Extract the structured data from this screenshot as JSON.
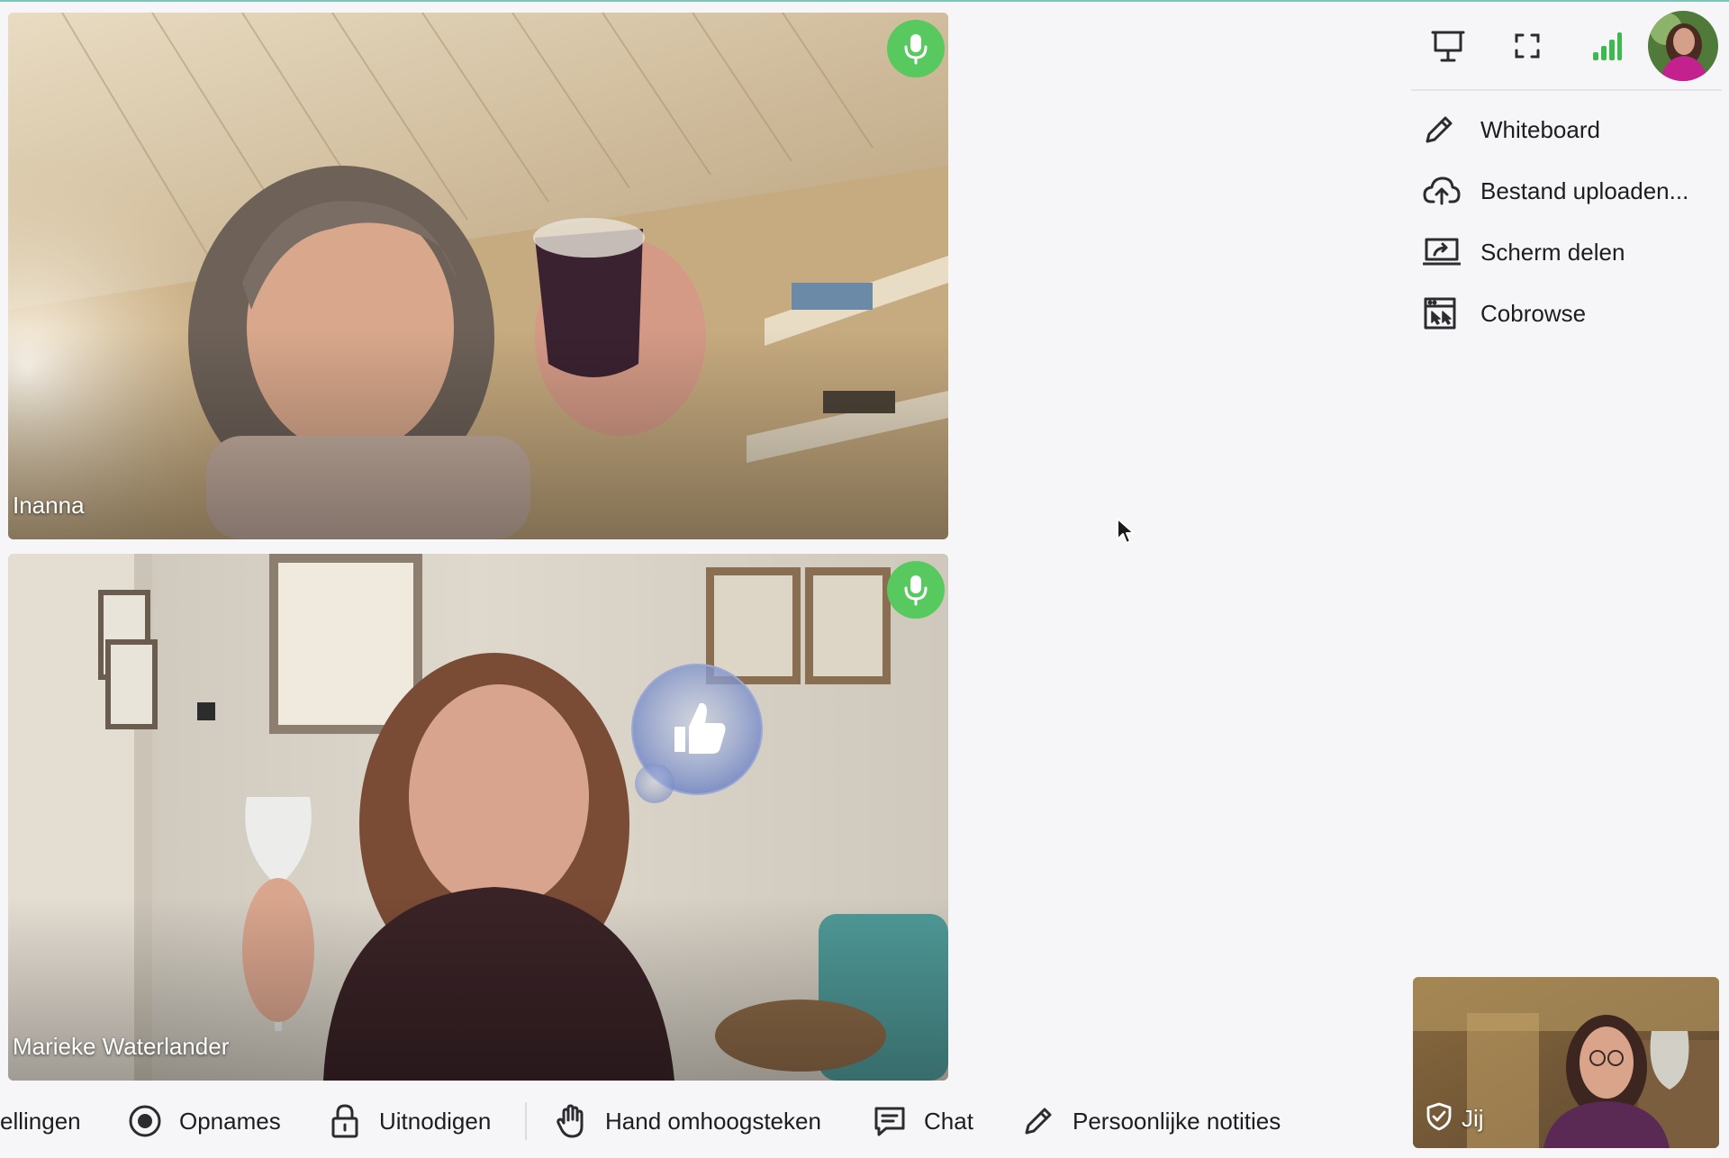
{
  "participants": [
    {
      "name": "Inanna",
      "mic": "mic-on-icon"
    },
    {
      "name": "Marieke Waterlander",
      "mic": "mic-on-icon",
      "reaction": "thumbs-up-icon"
    }
  ],
  "top_toolbar": {
    "icons": [
      "presentation-icon",
      "fullscreen-icon",
      "signal-strength-icon"
    ],
    "avatar": "user-avatar"
  },
  "share_menu": {
    "items": [
      {
        "label": "Whiteboard",
        "icon": "pencil-icon"
      },
      {
        "label": "Bestand uploaden...",
        "icon": "cloud-upload-icon"
      },
      {
        "label": "Scherm delen",
        "icon": "screen-share-icon"
      },
      {
        "label": "Cobrowse",
        "icon": "cobrowse-icon"
      }
    ]
  },
  "bottom_toolbar": {
    "items": [
      {
        "label": "ellingen",
        "icon": ""
      },
      {
        "label": "Opnames",
        "icon": "record-icon"
      },
      {
        "label": "Uitnodigen",
        "icon": "lock-icon"
      },
      {
        "label": "Hand omhoogsteken",
        "icon": "hand-icon"
      },
      {
        "label": "Chat",
        "icon": "chat-icon"
      },
      {
        "label": "Persoonlijke notities",
        "icon": "pencil-icon"
      }
    ]
  },
  "self_view": {
    "label": "Jij",
    "icon": "shield-check-icon"
  },
  "colors": {
    "mic_badge": "#58c95e",
    "signal": "#3dba4e",
    "background": "#f6f6f8"
  }
}
